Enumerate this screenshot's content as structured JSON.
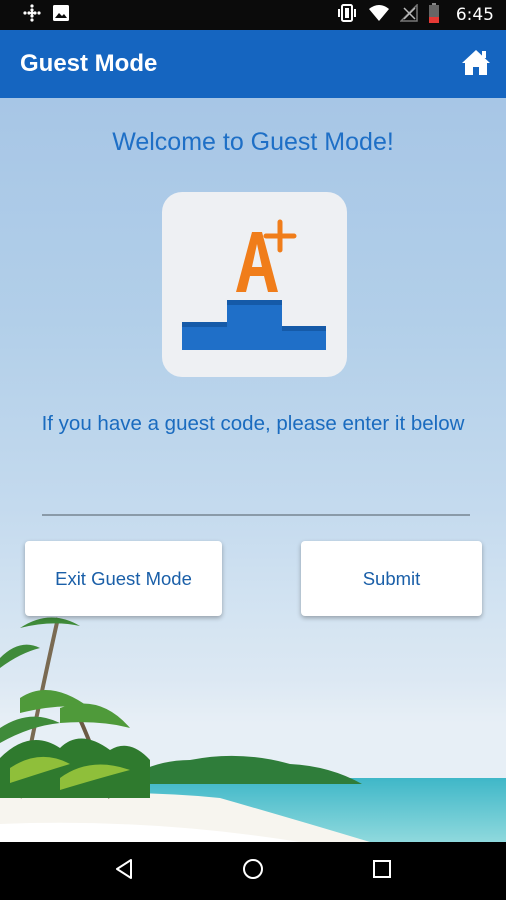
{
  "status_bar": {
    "time": "6:45",
    "icons": [
      "notification-dots-icon",
      "image-icon",
      "vibrate-icon",
      "wifi-icon",
      "no-signal-icon",
      "battery-icon"
    ]
  },
  "app_bar": {
    "title": "Guest Mode",
    "home_icon": "home-icon"
  },
  "main": {
    "welcome": "Welcome to Guest Mode!",
    "logo_icon": "a-plus-podium-logo",
    "instructions": "If you have a guest code, please enter it below",
    "code_input": {
      "value": "",
      "placeholder": ""
    },
    "exit_button": "Exit Guest Mode",
    "submit_button": "Submit"
  },
  "nav_bar": {
    "icons": [
      "back-icon",
      "home-circle-icon",
      "recents-icon"
    ]
  },
  "colors": {
    "app_bar": "#1565c0",
    "accent_text": "#1e6fc6",
    "logo_orange": "#f07d1a",
    "logo_blue": "#1f6fc8"
  }
}
